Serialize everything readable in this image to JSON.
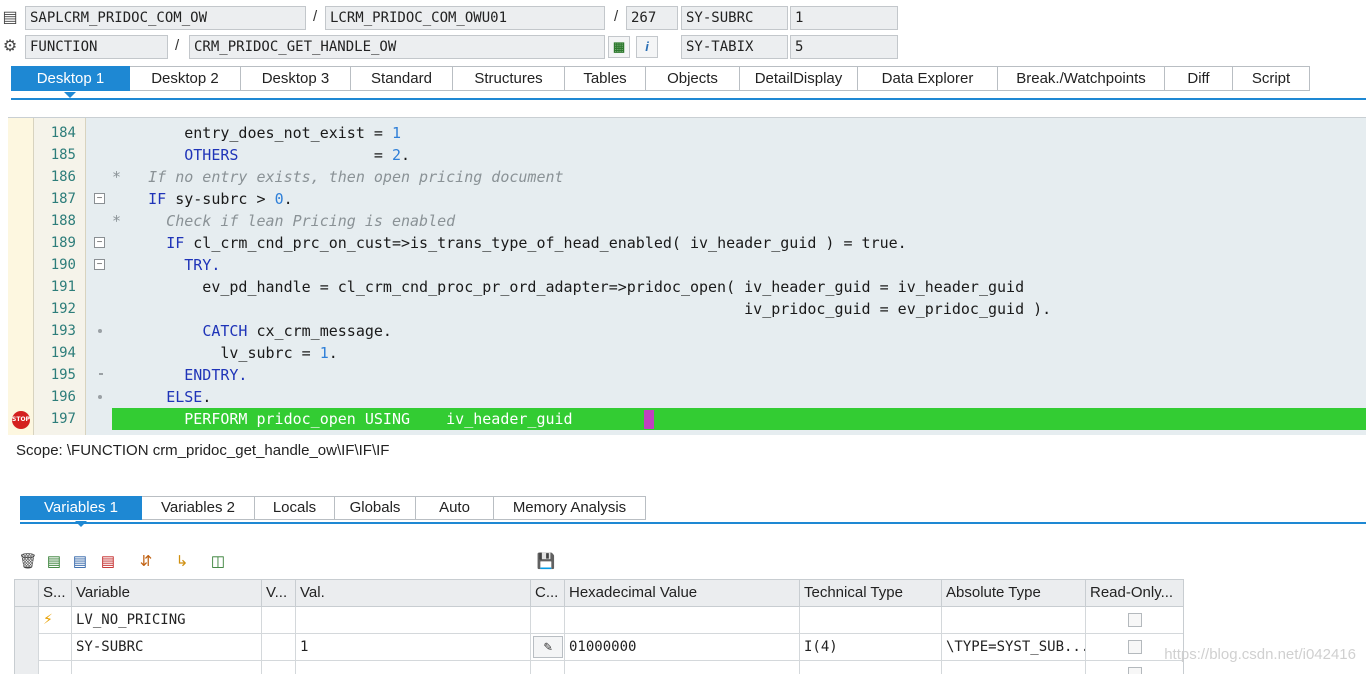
{
  "header": {
    "row1": {
      "program": "SAPLCRM_PRIDOC_COM_OW",
      "separator1": "/",
      "include": "LCRM_PRIDOC_COM_OWU01",
      "separator2": "/",
      "line": "267",
      "field_name": "SY-SUBRC",
      "field_value": "1"
    },
    "row2": {
      "event_type": "FUNCTION",
      "separator": "/",
      "event_name": "CRM_PRIDOC_GET_HANDLE_OW",
      "info_button": "i",
      "field_name": "SY-TABIX",
      "field_value": "5"
    }
  },
  "tabs": [
    "Desktop 1",
    "Desktop 2",
    "Desktop 3",
    "Standard",
    "Structures",
    "Tables",
    "Objects",
    "DetailDisplay",
    "Data Explorer",
    "Break./Watchpoints",
    "Diff",
    "Script"
  ],
  "active_tab": "Desktop 1",
  "code_lines": [
    {
      "num": "184",
      "code": "        entry_does_not_exist = 1"
    },
    {
      "num": "185",
      "code": "        OTHERS               = 2."
    },
    {
      "num": "186",
      "code": "*   If no entry exists, then open pricing document"
    },
    {
      "num": "187",
      "code": "    IF sy-subrc > 0."
    },
    {
      "num": "188",
      "code": "*     Check if lean Pricing is enabled"
    },
    {
      "num": "189",
      "code": "      IF cl_crm_cnd_prc_on_cust=>is_trans_type_of_head_enabled( iv_header_guid ) = true."
    },
    {
      "num": "190",
      "code": "        TRY."
    },
    {
      "num": "191",
      "code": "          ev_pd_handle = cl_crm_cnd_proc_pr_ord_adapter=>pridoc_open( iv_header_guid = iv_header_guid"
    },
    {
      "num": "192",
      "code": "                                                                      iv_pridoc_guid = ev_pridoc_guid )."
    },
    {
      "num": "193",
      "code": "          CATCH cx_crm_message."
    },
    {
      "num": "194",
      "code": "            lv_subrc = 1."
    },
    {
      "num": "195",
      "code": "        ENDTRY."
    },
    {
      "num": "196",
      "code": "      ELSE."
    },
    {
      "num": "197",
      "code": "        PERFORM pridoc_open USING    iv_header_guid"
    }
  ],
  "breakpoint_label": "STOP",
  "scope": "Scope: \\FUNCTION crm_pridoc_get_handle_ow\\IF\\IF\\IF",
  "subtabs": [
    "Variables 1",
    "Variables 2",
    "Locals",
    "Globals",
    "Auto",
    "Memory Analysis"
  ],
  "active_subtab": "Variables 1",
  "toolbar_icons": [
    "delete-icon",
    "insert-variable-icon",
    "variable-details-icon",
    "remove-variable-icon",
    "transfer-icon",
    "hierarchy-icon",
    "export-icon",
    "save-icon"
  ],
  "grid": {
    "headers": [
      "S...",
      "Variable",
      "V...",
      "Val.",
      "C...",
      "Hexadecimal Value",
      "Technical Type",
      "Absolute Type",
      "Read-Only..."
    ],
    "rows": [
      {
        "status_icon": "lightning-icon",
        "variable": "LV_NO_PRICING",
        "val": "",
        "hex": "",
        "tech": "",
        "abs": ""
      },
      {
        "status_icon": "",
        "variable": "SY-SUBRC",
        "val": "1",
        "hex": "01000000",
        "tech": "I(4)",
        "abs": "\\TYPE=SYST_SUB..."
      },
      {
        "status_icon": "",
        "variable": "",
        "val": "",
        "hex": "",
        "tech": "",
        "abs": ""
      }
    ]
  },
  "watermark": "https://blog.csdn.net/i042416",
  "colors": {
    "accent": "#1e88d3",
    "highlight": "#33cc33",
    "keyword": "#1f34b8",
    "number": "#2e7fd8",
    "comment": "#8a9296"
  }
}
